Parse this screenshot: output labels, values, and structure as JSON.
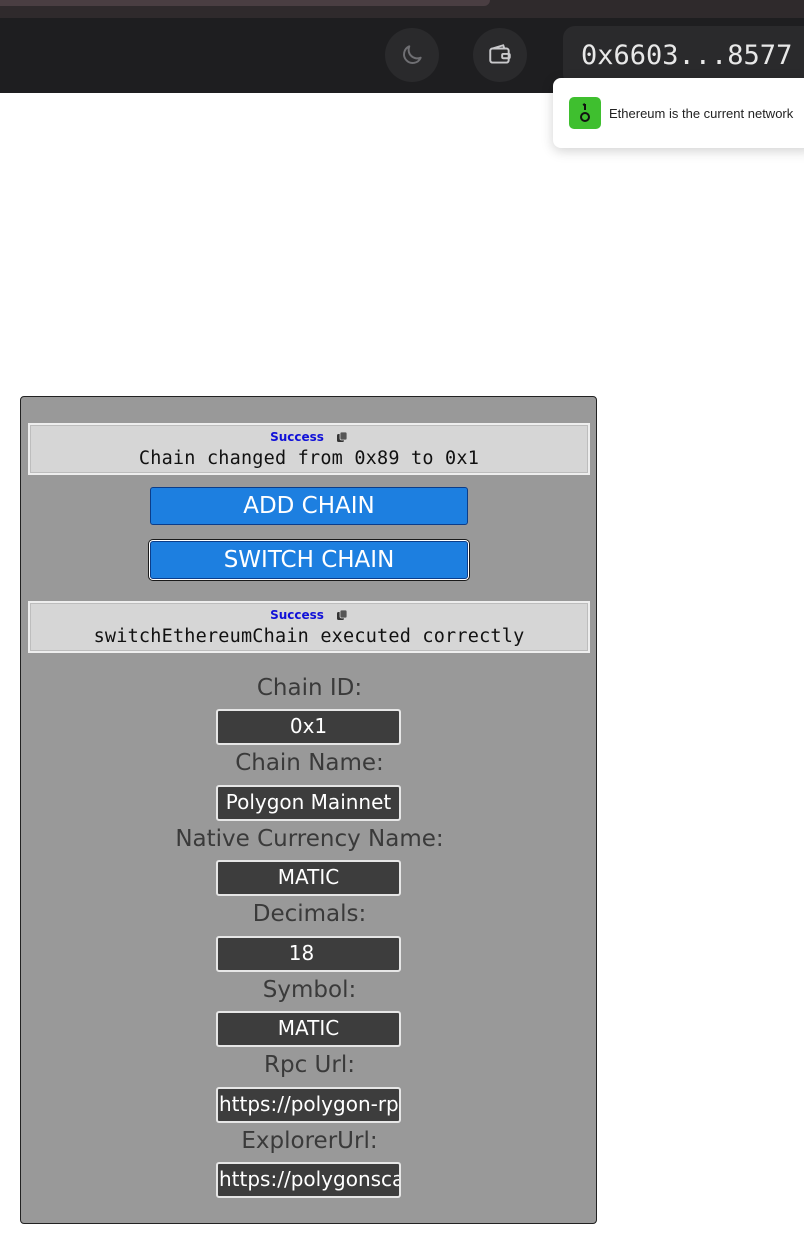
{
  "header": {
    "theme_icon": "moon-icon",
    "wallet_icon": "wallet-icon",
    "address": "0x6603...8577 ▾"
  },
  "toast": {
    "icon": "network-icon",
    "message": "Ethereum is the current network"
  },
  "panel": {
    "status1": {
      "label": "Success",
      "message": "Chain changed from 0x89 to 0x1"
    },
    "add_chain_label": "ADD CHAIN",
    "switch_chain_label": "SWITCH CHAIN",
    "status2": {
      "label": "Success",
      "message": "switchEthereumChain executed correctly"
    },
    "fields": {
      "chain_id": {
        "label": "Chain ID:",
        "value": "0x1"
      },
      "chain_name": {
        "label": "Chain Name:",
        "value": "Polygon Mainnet"
      },
      "currency_name": {
        "label": "Native Currency Name:",
        "value": "MATIC"
      },
      "decimals": {
        "label": "Decimals:",
        "value": "18"
      },
      "symbol": {
        "label": "Symbol:",
        "value": "MATIC"
      },
      "rpc_url": {
        "label": "Rpc Url:",
        "value": "https://polygon-rpc.com"
      },
      "explorer_url": {
        "label": "ExplorerUrl:",
        "value": "https://polygonscan.com"
      }
    }
  },
  "colors": {
    "header_bg": "#1e1e20",
    "panel_bg": "#999999",
    "button_blue": "#1d7fe0",
    "success_blue": "#1010d8",
    "toast_icon_green": "#3fbf2f"
  }
}
